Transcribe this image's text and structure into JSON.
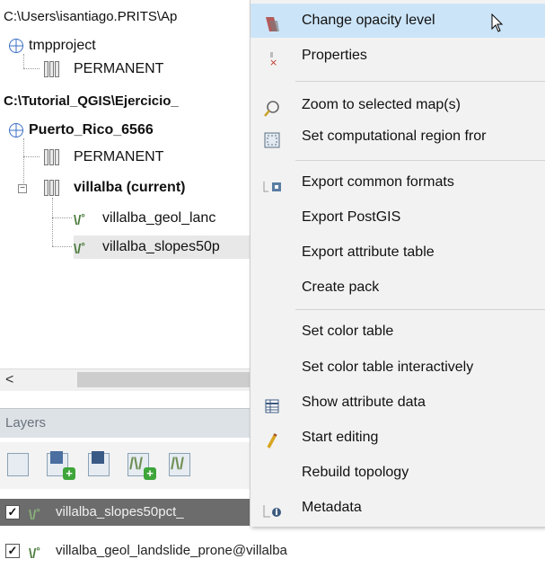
{
  "tree": {
    "rows": [
      {
        "label": "C:\\Users\\isantiago.PRITS\\Ap"
      },
      {
        "label": "tmpproject"
      },
      {
        "label": "PERMANENT"
      },
      {
        "label": "C:\\Tutorial_QGIS\\Ejercicio_"
      },
      {
        "label": "Puerto_Rico_6566"
      },
      {
        "label": "PERMANENT"
      },
      {
        "label": "villalba  (current)"
      },
      {
        "label": "villalba_geol_lanc"
      },
      {
        "label": "villalba_slopes50p"
      }
    ]
  },
  "scrollbar": {
    "left_arrow": "<"
  },
  "layers_panel": {
    "header": "Layers",
    "rows": [
      {
        "label": "villalba_slopes50pct_",
        "checked": true
      },
      {
        "label": "villalba_geol_landslide_prone@villalba",
        "checked": true
      }
    ]
  },
  "context_menu": {
    "items": [
      {
        "label": "Change opacity level",
        "icon": "opacity-icon",
        "highlighted": true
      },
      {
        "label": "Properties",
        "icon": "properties-icon"
      },
      {
        "label": "Zoom to selected map(s)",
        "icon": "zoom-icon"
      },
      {
        "label": "Set computational region fror",
        "icon": "region-icon"
      },
      {
        "label": "Export common formats",
        "icon": "export-icon"
      },
      {
        "label": "Export PostGIS",
        "icon": ""
      },
      {
        "label": "Export attribute table",
        "icon": ""
      },
      {
        "label": "Create pack",
        "icon": ""
      },
      {
        "label": "Set color table",
        "icon": ""
      },
      {
        "label": "Set color table interactively",
        "icon": ""
      },
      {
        "label": "Show attribute data",
        "icon": "table-icon"
      },
      {
        "label": "Start editing",
        "icon": "pencil-icon"
      },
      {
        "label": "Rebuild topology",
        "icon": ""
      },
      {
        "label": "Metadata",
        "icon": "metadata-icon"
      }
    ]
  },
  "colors": {
    "highlight": "#cce4f7",
    "selected_layer": "#6c6c6c",
    "panel_header": "#dde2e7"
  }
}
